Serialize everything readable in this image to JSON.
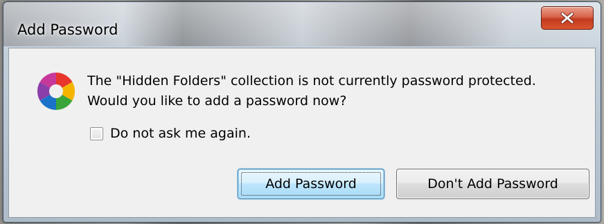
{
  "window": {
    "title": "Add Password",
    "close_label": "X"
  },
  "dialog": {
    "app_icon": "picasa-logo-icon",
    "message_line1": "The \"Hidden Folders\" collection is not currently password protected.",
    "message_line2": "Would you like to add a password now?",
    "checkbox_label": "Do not ask me again.",
    "checkbox_checked": false,
    "primary_button": "Add Password",
    "secondary_button": "Don't Add Password"
  },
  "colors": {
    "close_button": "#c94a32",
    "default_button_border": "#3c7fb1",
    "dialog_background": "#f0f0f0"
  }
}
